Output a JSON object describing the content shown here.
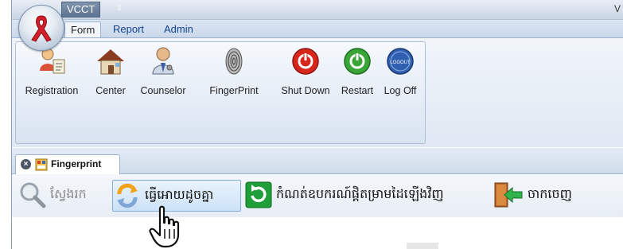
{
  "window": {
    "title": "VCCT",
    "qat_caret": "⇩",
    "right_glyph": "V"
  },
  "ribbon": {
    "tabs": [
      {
        "label": "Form",
        "active": true
      },
      {
        "label": "Report",
        "active": false
      },
      {
        "label": "Admin",
        "active": false
      }
    ],
    "buttons": [
      {
        "label": "Registration",
        "icon": "registration-icon"
      },
      {
        "label": "Center",
        "icon": "house-icon"
      },
      {
        "label": "Counselor",
        "icon": "counselor-icon"
      },
      {
        "label": "FingerPrint",
        "icon": "fingerprint-icon"
      },
      {
        "label": "Shut Down",
        "icon": "power-icon"
      },
      {
        "label": "Restart",
        "icon": "restart-icon"
      },
      {
        "label": "Log Off",
        "icon": "logoff-icon"
      }
    ],
    "logoff_badge": "LOGOUT"
  },
  "document_tab": {
    "label": "Fingerprint",
    "close_glyph": "×"
  },
  "toolbar": {
    "search_label": "ស្វែងរក",
    "match_label": "ធ្វើអោយដូចគ្នា",
    "reset_label": "កំណត់ឧបករណ៍ផ្តិតម្រាមដៃឡើងវិញ",
    "exit_label": "ចាកចេញ"
  },
  "colors": {
    "ribbon_accent": "#15428b",
    "power_red": "#d7261c",
    "restart_green": "#3aa537",
    "logoff_blue": "#2f5fae",
    "hover_border": "#86aedb"
  }
}
